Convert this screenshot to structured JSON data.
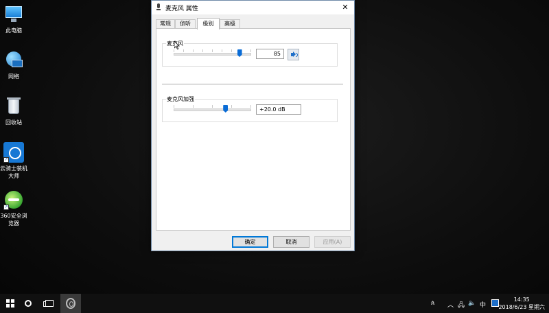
{
  "desktop": {
    "icons": [
      {
        "label": "此电脑",
        "icon": "this-pc-icon"
      },
      {
        "label": "网络",
        "icon": "network-icon"
      },
      {
        "label": "回收站",
        "icon": "recycle-bin-icon"
      },
      {
        "label": "云骑士装机大师",
        "icon": "yunqishi-icon"
      },
      {
        "label": "360安全浏览器",
        "icon": "360-browser-icon"
      }
    ]
  },
  "dialog": {
    "title": "麦克风 属性",
    "close_label": "✕",
    "tabs": [
      {
        "label": "常规"
      },
      {
        "label": "侦听"
      },
      {
        "label": "级别",
        "active": true
      },
      {
        "label": "高级"
      }
    ],
    "mic_level": {
      "label": "麦克风",
      "value": "85",
      "level_percent": 85
    },
    "mic_boost": {
      "label": "麦克风加强",
      "value": "+20.0 dB",
      "level_fraction": 0.67
    },
    "buttons": {
      "ok": "确定",
      "cancel": "取消",
      "apply": "应用(A)"
    }
  },
  "taskbar": {
    "ime": "中",
    "time": "14:35",
    "date": "2018/6/23 星期六"
  },
  "colors": {
    "accent": "#0a6cd6",
    "taskbar": "#101010"
  }
}
